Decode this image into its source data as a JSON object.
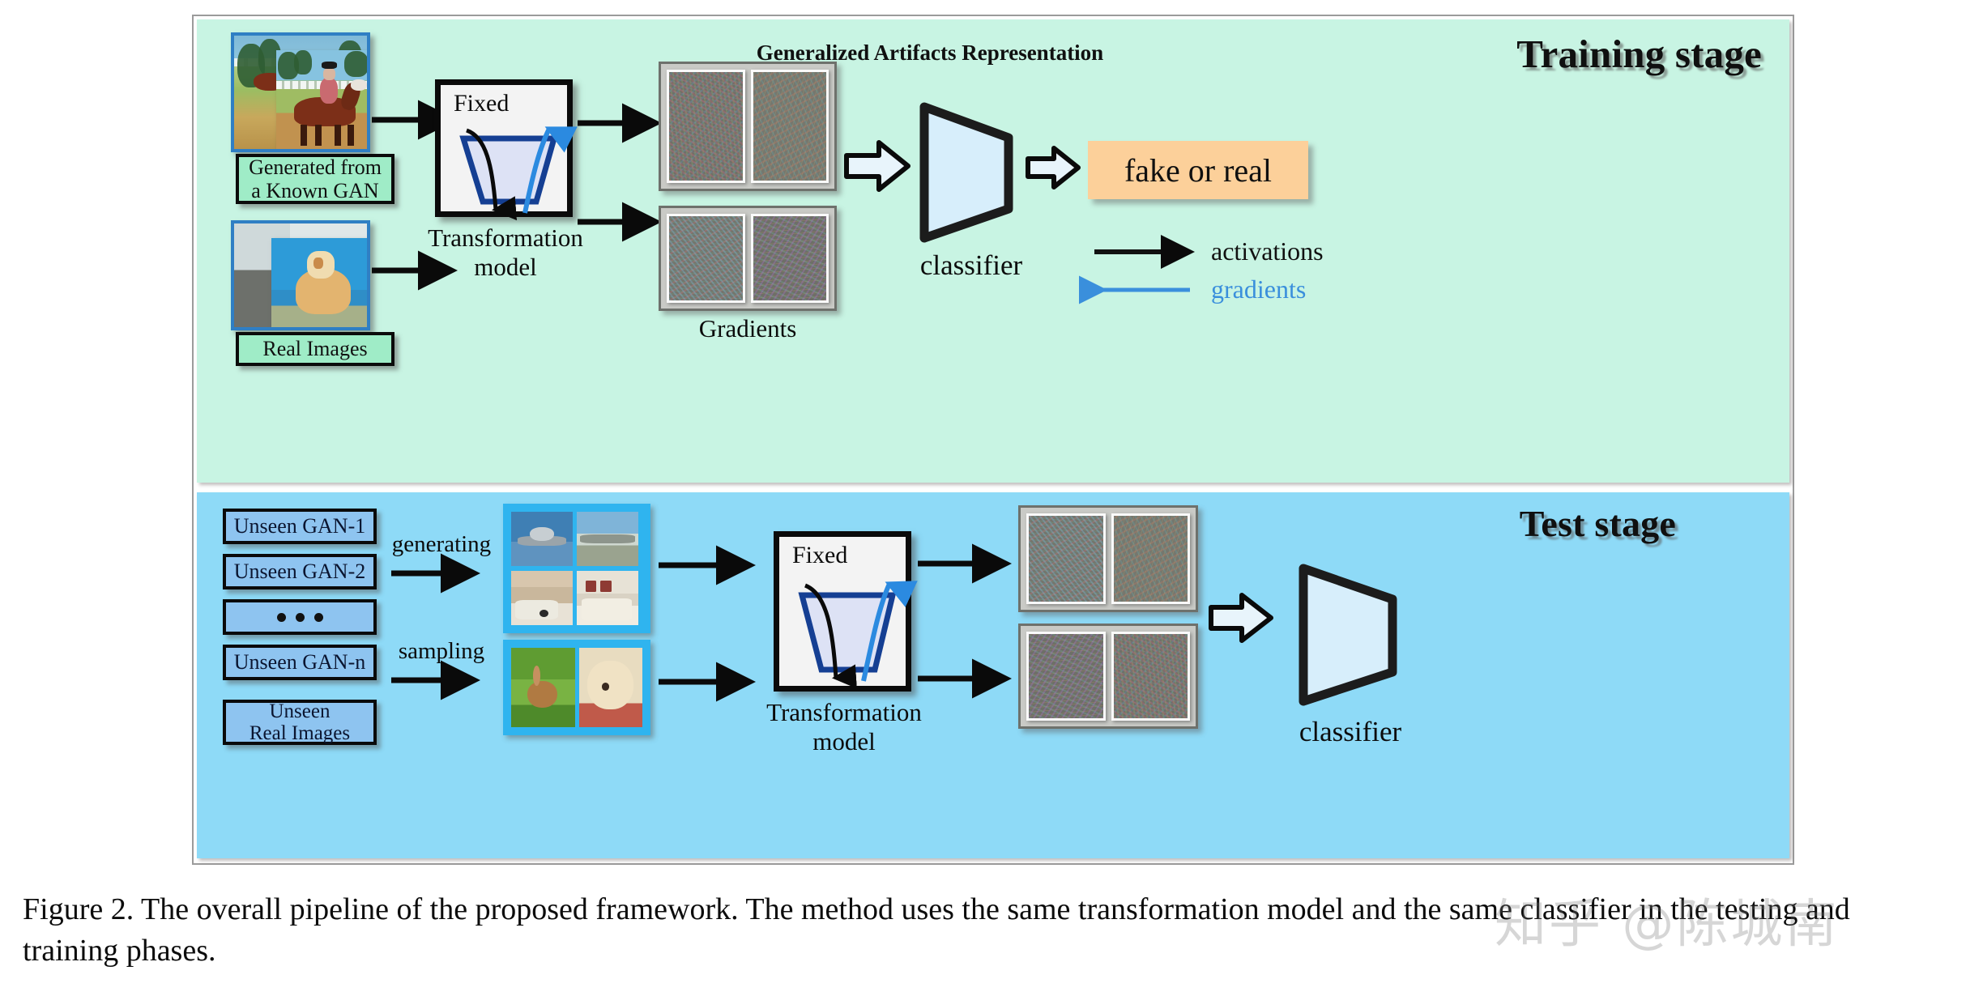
{
  "figure": {
    "caption": "Figure 2. The overall pipeline of the proposed framework. The method uses the same transformation model and the same classifier in the testing and training phases.",
    "watermark": "知乎 @陈城南"
  },
  "training_stage": {
    "title": "Training stage",
    "inputs": [
      {
        "label": "Generated from\na Known GAN",
        "line1": "Generated from",
        "line2": "a Known GAN",
        "icon": "photo-stack-icon"
      },
      {
        "label": "Real Images",
        "line1": "Real Images",
        "line2": "",
        "icon": "photo-stack-icon"
      }
    ],
    "transform_box": {
      "fixed_label": "Fixed",
      "caption_line1": "Transformation",
      "caption_line2": "model",
      "icon": "funnel-icon"
    },
    "artifacts_header": "Generalized Artifacts Representation",
    "gradients_caption": "Gradients",
    "classifier_label": "classifier",
    "output_label": "fake or real",
    "legend": [
      {
        "text": "activations",
        "color": "#111111",
        "direction": "right",
        "icon": "arrow-right-icon"
      },
      {
        "text": "gradients",
        "color": "#3a8fdc",
        "direction": "left",
        "icon": "arrow-left-icon"
      }
    ]
  },
  "test_stage": {
    "title": "Test stage",
    "gan_items": [
      {
        "label": "Unseen GAN-1"
      },
      {
        "label": "Unseen GAN-2"
      },
      {
        "label": "• • •"
      },
      {
        "label": "Unseen GAN-n"
      }
    ],
    "real_item": {
      "line1": "Unseen",
      "line2": "Real Images"
    },
    "operations": [
      {
        "label": "generating",
        "icon": "arrow-right-icon"
      },
      {
        "label": "sampling",
        "icon": "arrow-right-icon"
      }
    ],
    "transform_box": {
      "fixed_label": "Fixed",
      "caption_line1": "Transformation",
      "caption_line2": "model",
      "icon": "funnel-icon"
    },
    "classifier_label": "classifier"
  },
  "colors": {
    "training_bg": "#c8f4e3",
    "test_bg": "#8edaf7",
    "output_box": "#fcd09a",
    "classifier_fill": "#d7eefb",
    "gradient_blue": "#3a8fdc",
    "funnel_stroke": "#153f93",
    "gan_box": "#8ec4f0",
    "plaque_green": "#9fecc7"
  }
}
